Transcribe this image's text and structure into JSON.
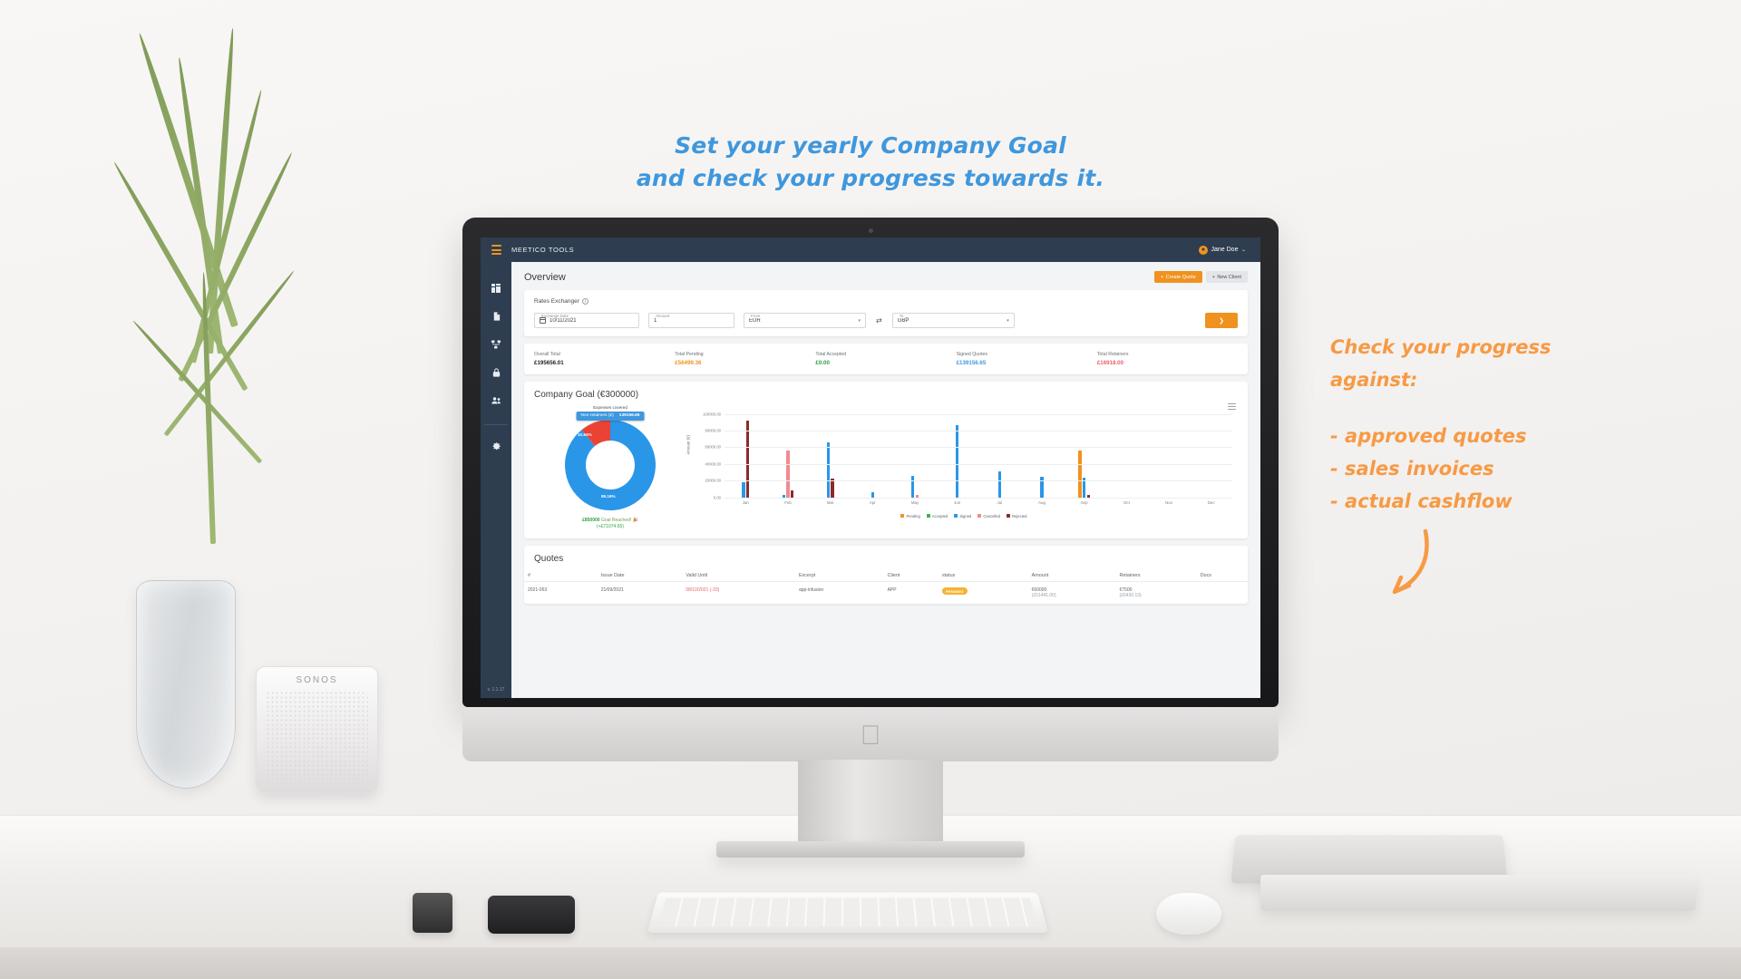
{
  "marketing": {
    "headline_line1": "Set your yearly Company Goal",
    "headline_line2": "and check your progress towards it.",
    "headline_color": "#3f97dd",
    "annotation_lead1": "Check your progress",
    "annotation_lead2": "against:",
    "annotation_items": [
      "- approved quotes",
      "- sales invoices",
      "- actual cashflow"
    ],
    "annotation_color": "#f79a45"
  },
  "device": {
    "speaker_brand": "SONOS"
  },
  "app": {
    "topbar": {
      "menu_icon": "hamburger-icon",
      "brand": "MEETICO TOOLS",
      "user_name": "Jane Doe",
      "user_icon": "user-avatar-icon",
      "chevron": "⌄"
    },
    "sidebar": {
      "items": [
        {
          "name": "dashboard",
          "icon": "grid-dashboard-icon"
        },
        {
          "name": "documents",
          "icon": "document-icon"
        },
        {
          "name": "projects",
          "icon": "sitemap-icon"
        },
        {
          "name": "security",
          "icon": "lock-icon"
        },
        {
          "name": "clients",
          "icon": "users-icon"
        },
        {
          "name": "settings",
          "icon": "gear-icon"
        }
      ],
      "version": "v. 1.1.17"
    },
    "page": {
      "title": "Overview",
      "create_quote": "Create Quote",
      "new_client": "New Client",
      "plus": "+"
    },
    "rates": {
      "section_label": "Rates Exchanger",
      "info_icon": "info-circle-icon",
      "date_label": "Exchange Date",
      "date_value": "10/11/2021",
      "calendar_icon": "calendar-icon",
      "amount_label": "Amount",
      "amount_value": "1",
      "from_label": "From",
      "from_value": "EUR",
      "to_label": "To",
      "to_value": "GBP",
      "swap_icon": "⇄",
      "go_icon": "❯",
      "caret": "▾"
    },
    "stats": [
      {
        "label": "Overall Total",
        "value": "£195656.01",
        "color": "#202124"
      },
      {
        "label": "Total Pending",
        "value": "£56499.36",
        "color": "#f0921f"
      },
      {
        "label": "Total Accepted",
        "value": "£0.00",
        "color": "#2f9e44"
      },
      {
        "label": "Signed Quotes",
        "value": "£139156.65",
        "color": "#3f97dd"
      },
      {
        "label": "Total Retainers",
        "value": "£16918.00",
        "color": "#e8616c"
      }
    ],
    "goal": {
      "title": "Company Goal (€300000)",
      "expenses_covered": "Expenses covered",
      "tooltip_label": "Non-retainers (£)",
      "tooltip_value": "139156.65",
      "reached_amount": "£850000",
      "reached_text": "Goal Reached!",
      "reached_emoji": "🎉",
      "surplus": "(+£71074.65)",
      "menu_icon": "chart-menu-icon"
    },
    "quotes": {
      "title": "Quotes",
      "columns": [
        "#",
        "Issue Date",
        "Valid Until",
        "Excerpt",
        "Client",
        "status",
        "Amount",
        "Retainers",
        "Docs"
      ],
      "rows": [
        {
          "id": "2021-053",
          "issue_date": "21/09/2021",
          "valid_until": "08/10/2021 (-33)",
          "excerpt": "app-infusion",
          "client": "APP",
          "status": "PENDING",
          "amount": "€60000",
          "amount_sub": "(£51441.00)",
          "retainers": "€7500",
          "retainers_sub": "(£6430.13)",
          "docs": ""
        }
      ]
    },
    "chart_data": {
      "type": "bar",
      "title": "",
      "xlabel": "",
      "ylabel": "Amount (€)",
      "ylim": [
        0,
        100000
      ],
      "yticks": [
        0,
        20000,
        40000,
        60000,
        80000,
        100000
      ],
      "ytick_labels": [
        "0.00",
        "20000.00",
        "40000.00",
        "60000.00",
        "80000.00",
        "100000.00"
      ],
      "categories": [
        "Jan",
        "Feb",
        "Mar",
        "Apr",
        "May",
        "Jun",
        "Jul",
        "Aug",
        "Sep",
        "Oct",
        "Nov",
        "Dec"
      ],
      "legend_position": "bottom",
      "grid": true,
      "series": [
        {
          "name": "Pending",
          "color": "#f0921f",
          "values": [
            0,
            0,
            0,
            0,
            0,
            0,
            0,
            0,
            56500,
            0,
            0,
            0
          ]
        },
        {
          "name": "Accepted",
          "color": "#3cb44b",
          "values": [
            0,
            0,
            0,
            0,
            0,
            0,
            0,
            0,
            0,
            0,
            0,
            0
          ]
        },
        {
          "name": "Signed",
          "color": "#2a96e8",
          "values": [
            17500,
            3200,
            66000,
            5500,
            25500,
            86000,
            31500,
            25000,
            23500,
            0,
            0,
            0
          ]
        },
        {
          "name": "Cancelled",
          "color": "#f08a8f",
          "values": [
            0,
            56500,
            0,
            0,
            3000,
            0,
            0,
            0,
            0,
            0,
            0,
            0
          ]
        },
        {
          "name": "Rejected",
          "color": "#8b2b2b",
          "values": [
            92000,
            8500,
            22500,
            0,
            0,
            0,
            0,
            0,
            2500,
            0,
            0,
            0
          ]
        }
      ]
    },
    "donut_data": {
      "type": "pie",
      "segments": [
        {
          "name": "Non-retainers",
          "value": 89.16,
          "label": "89.16%",
          "color": "#2a96e8"
        },
        {
          "name": "Retainers",
          "value": 10.84,
          "label": "10.84%",
          "color": "#ea4335"
        }
      ]
    }
  }
}
